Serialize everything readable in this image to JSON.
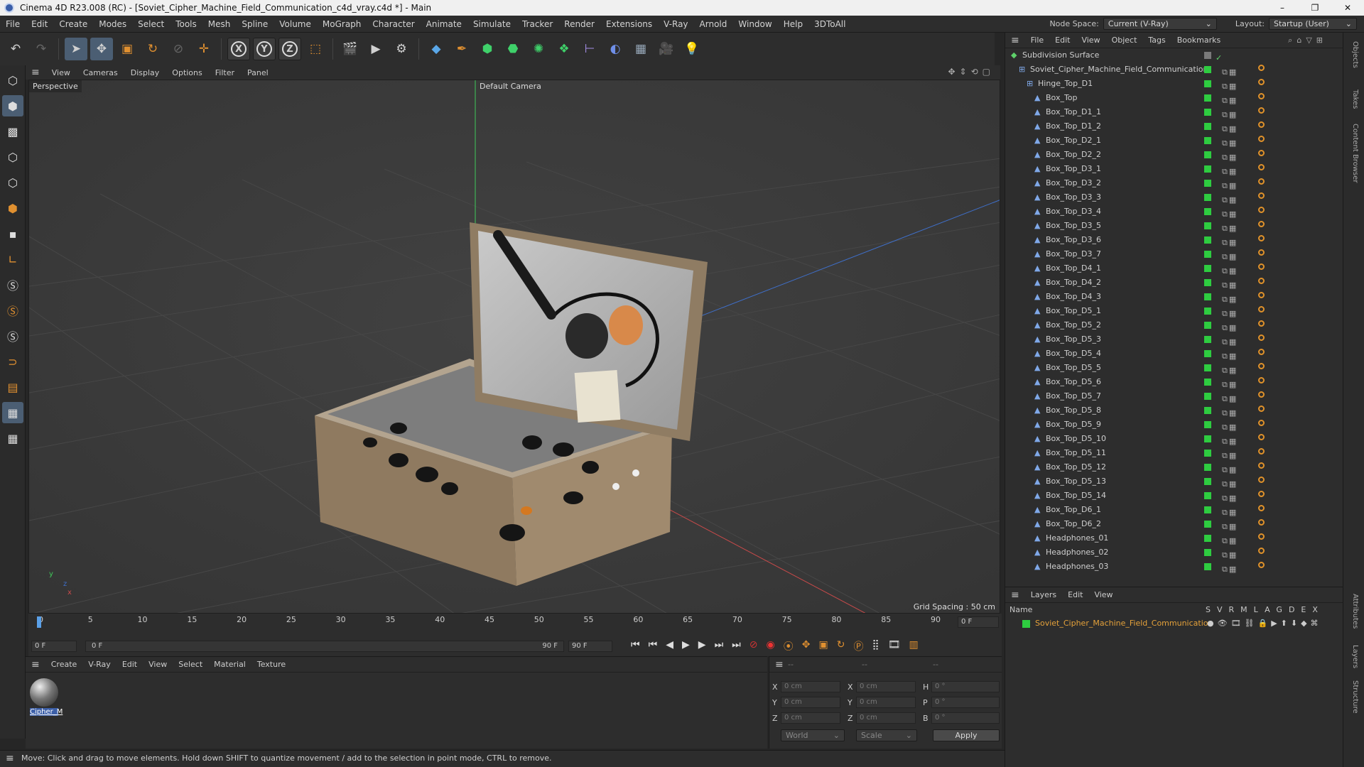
{
  "window": {
    "title": "Cinema 4D R23.008 (RC) - [Soviet_Cipher_Machine_Field_Communication_c4d_vray.c4d *] - Main",
    "controls": [
      "–",
      "❐",
      "✕"
    ]
  },
  "menu": {
    "items": [
      "File",
      "Edit",
      "Create",
      "Modes",
      "Select",
      "Tools",
      "Mesh",
      "Spline",
      "Volume",
      "MoGraph",
      "Character",
      "Animate",
      "Simulate",
      "Tracker",
      "Render",
      "Extensions",
      "V-Ray",
      "Arnold",
      "Window",
      "Help",
      "3DToAll"
    ],
    "node_space_label": "Node Space:",
    "node_space_value": "Current (V-Ray)",
    "layout_label": "Layout:",
    "layout_value": "Startup (User)"
  },
  "toolbar": {
    "axis_x": "X",
    "axis_y": "Y",
    "axis_z": "Z"
  },
  "viewport": {
    "menu": [
      "View",
      "Cameras",
      "Display",
      "Options",
      "Filter",
      "Panel"
    ],
    "view_name": "Perspective",
    "camera": "Default Camera",
    "grid_spacing": "Grid Spacing : 50 cm",
    "axis_y": "y",
    "axis_z": "z",
    "axis_x": "x"
  },
  "objects": {
    "menu": [
      "File",
      "Edit",
      "View",
      "Object",
      "Tags",
      "Bookmarks"
    ],
    "rows": [
      {
        "name": "Subdivision Surface",
        "indent": 0
      },
      {
        "name": "Soviet_Cipher_Machine_Field_Communication",
        "indent": 1
      },
      {
        "name": "Hinge_Top_D1",
        "indent": 2
      },
      {
        "name": "Box_Top",
        "indent": 3
      },
      {
        "name": "Box_Top_D1_1",
        "indent": 3
      },
      {
        "name": "Box_Top_D1_2",
        "indent": 3
      },
      {
        "name": "Box_Top_D2_1",
        "indent": 3
      },
      {
        "name": "Box_Top_D2_2",
        "indent": 3
      },
      {
        "name": "Box_Top_D3_1",
        "indent": 3
      },
      {
        "name": "Box_Top_D3_2",
        "indent": 3
      },
      {
        "name": "Box_Top_D3_3",
        "indent": 3
      },
      {
        "name": "Box_Top_D3_4",
        "indent": 3
      },
      {
        "name": "Box_Top_D3_5",
        "indent": 3
      },
      {
        "name": "Box_Top_D3_6",
        "indent": 3
      },
      {
        "name": "Box_Top_D3_7",
        "indent": 3
      },
      {
        "name": "Box_Top_D4_1",
        "indent": 3
      },
      {
        "name": "Box_Top_D4_2",
        "indent": 3
      },
      {
        "name": "Box_Top_D4_3",
        "indent": 3
      },
      {
        "name": "Box_Top_D5_1",
        "indent": 3
      },
      {
        "name": "Box_Top_D5_2",
        "indent": 3
      },
      {
        "name": "Box_Top_D5_3",
        "indent": 3
      },
      {
        "name": "Box_Top_D5_4",
        "indent": 3
      },
      {
        "name": "Box_Top_D5_5",
        "indent": 3
      },
      {
        "name": "Box_Top_D5_6",
        "indent": 3
      },
      {
        "name": "Box_Top_D5_7",
        "indent": 3
      },
      {
        "name": "Box_Top_D5_8",
        "indent": 3
      },
      {
        "name": "Box_Top_D5_9",
        "indent": 3
      },
      {
        "name": "Box_Top_D5_10",
        "indent": 3
      },
      {
        "name": "Box_Top_D5_11",
        "indent": 3
      },
      {
        "name": "Box_Top_D5_12",
        "indent": 3
      },
      {
        "name": "Box_Top_D5_13",
        "indent": 3
      },
      {
        "name": "Box_Top_D5_14",
        "indent": 3
      },
      {
        "name": "Box_Top_D6_1",
        "indent": 3
      },
      {
        "name": "Box_Top_D6_2",
        "indent": 3
      },
      {
        "name": "Headphones_01",
        "indent": 3
      },
      {
        "name": "Headphones_02",
        "indent": 3
      },
      {
        "name": "Headphones_03",
        "indent": 3
      }
    ]
  },
  "layers": {
    "menu": [
      "Layers",
      "Edit",
      "View"
    ],
    "col_name": "Name",
    "cols": [
      "S",
      "V",
      "R",
      "M",
      "L",
      "A",
      "G",
      "D",
      "E",
      "X"
    ],
    "item": "Soviet_Cipher_Machine_Field_Communication"
  },
  "right_tabs": [
    "Objects",
    "Takes",
    "Content Browser",
    "Attributes",
    "Layers",
    "Structure"
  ],
  "timeline": {
    "ticks": [
      "0",
      "5",
      "10",
      "15",
      "20",
      "25",
      "30",
      "35",
      "40",
      "45",
      "50",
      "55",
      "60",
      "65",
      "70",
      "75",
      "80",
      "85",
      "90"
    ],
    "current_frame": "0 F",
    "start": "0 F",
    "range_start": "0 F",
    "range_end": "90 F",
    "end": "90 F"
  },
  "materials": {
    "menu": [
      "Create",
      "V-Ray",
      "Edit",
      "View",
      "Select",
      "Material",
      "Texture"
    ],
    "items": [
      {
        "name": "Cipher_M"
      }
    ]
  },
  "coords": {
    "headers": [
      "--",
      "--",
      "--"
    ],
    "pos": [
      {
        "axis": "X",
        "value": "0 cm"
      },
      {
        "axis": "Y",
        "value": "0 cm"
      },
      {
        "axis": "Z",
        "value": "0 cm"
      }
    ],
    "size": [
      {
        "axis": "X",
        "value": "0 cm"
      },
      {
        "axis": "Y",
        "value": "0 cm"
      },
      {
        "axis": "Z",
        "value": "0 cm"
      }
    ],
    "rot": [
      {
        "axis": "H",
        "value": "0 °"
      },
      {
        "axis": "P",
        "value": "0 °"
      },
      {
        "axis": "B",
        "value": "0 °"
      }
    ],
    "world": "World",
    "scale": "Scale",
    "apply": "Apply"
  },
  "status": "Move: Click and drag to move elements. Hold down SHIFT to quantize movement / add to the selection in point mode, CTRL to remove.",
  "colors": {
    "green_dot": "#2ecc40",
    "orange_tag": "#e0922a",
    "active_tool": "#4b5e73",
    "layer_name": "#e4a13a"
  }
}
